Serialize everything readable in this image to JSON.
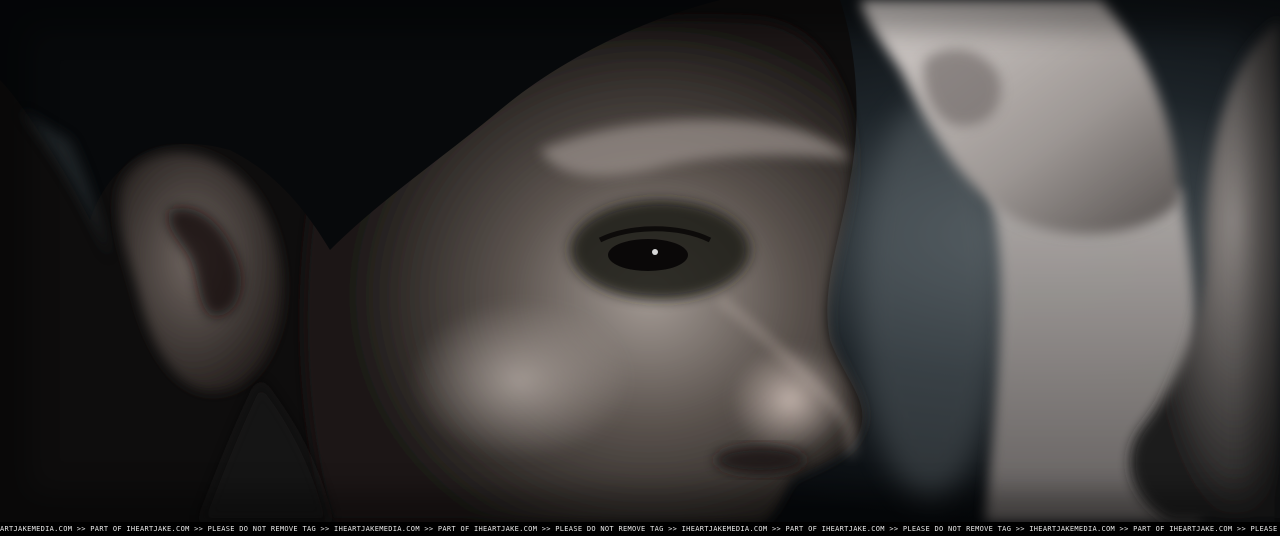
{
  "image": {
    "subject": "close-up-profile-face",
    "colors": {
      "background": "#0b1015",
      "skin_highlight": "#c9c1bc",
      "skin_shadow": "#2a2522",
      "hair": "#07090b",
      "hand": "#bdb7b4",
      "tag_bar": "#000000",
      "tag_text": "#e6e6e6"
    }
  },
  "watermark": {
    "text": "ARTJAKEMEDIA.COM >> PART OF IHEARTJAKE.COM >> PLEASE DO NOT REMOVE TAG >> IHEARTJAKEMEDIA.COM >> PART OF IHEARTJAKE.COM >> PLEASE DO NOT REMOVE TAG >> IHEARTJAKEMEDIA.COM >> PART OF IHEARTJAKE.COM >> PLEASE DO NOT REMOVE TAG >> IHEARTJAKEMEDIA.COM >> PART OF IHEARTJAKE.COM >> PLEASE"
  }
}
